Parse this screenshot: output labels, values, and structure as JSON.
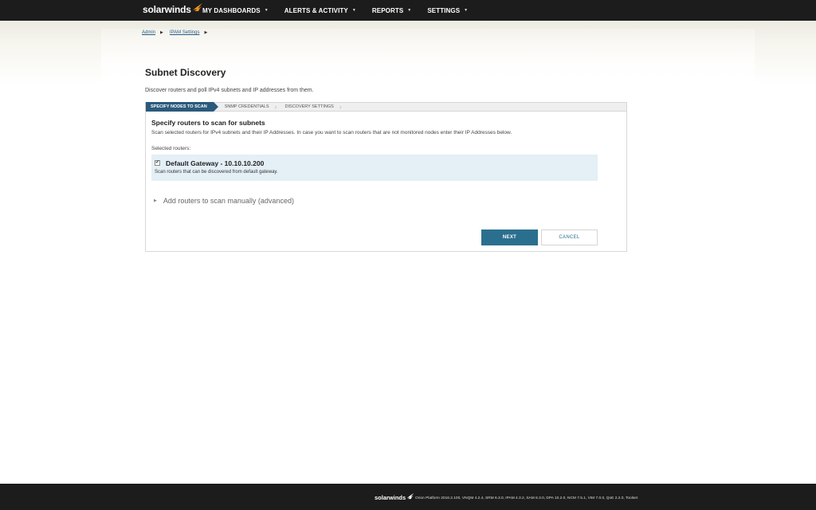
{
  "brand": {
    "name": "solarwinds",
    "accent_color": "#f7941d"
  },
  "nav": {
    "items": [
      {
        "label": "MY DASHBOARDS"
      },
      {
        "label": "ALERTS & ACTIVITY"
      },
      {
        "label": "REPORTS"
      },
      {
        "label": "SETTINGS"
      }
    ],
    "caret_icon": "caret-down-icon"
  },
  "breadcrumb": [
    {
      "label": "Admin"
    },
    {
      "label": "IPAM Settings"
    }
  ],
  "page": {
    "title": "Subnet Discovery",
    "description": "Discover routers and poll IPv4 subnets and IP addresses from them."
  },
  "wizard": {
    "steps": [
      {
        "label": "SPECIFY NODES TO SCAN",
        "active": true
      },
      {
        "label": "SNMP CREDENTIALS",
        "active": false
      },
      {
        "label": "DISCOVERY SETTINGS",
        "active": false
      }
    ],
    "active_color": "#2b5a7c"
  },
  "section": {
    "title": "Specify routers to scan for subnets",
    "description": "Scan selected routers for IPv4 subnets and their IP Addresses. In case you want to scan routers that are not monitored nodes enter their IP Addresses below.",
    "selected_label": "Selected routers:",
    "routers": [
      {
        "name": "Default Gateway - 10.10.10.200",
        "description": "Scan routers that can be discovered from default gateway.",
        "checked": true
      }
    ],
    "add_manual_label": "Add routers to scan manually (advanced)"
  },
  "buttons": {
    "next_label": "NEXT",
    "cancel_label": "CANCEL",
    "primary_color": "#2b6f8f"
  },
  "footer": {
    "brand": "solarwinds",
    "versions": "Orion Platform 2016.2.100, VNQM 4.2.4, SRM 6.3.0, IPAM 4.3.2, SAM 6.3.0, DPA 10.2.0, NCM 7.5.1, VIM 7.0.0, QoE 2.2.0, Toolset"
  }
}
